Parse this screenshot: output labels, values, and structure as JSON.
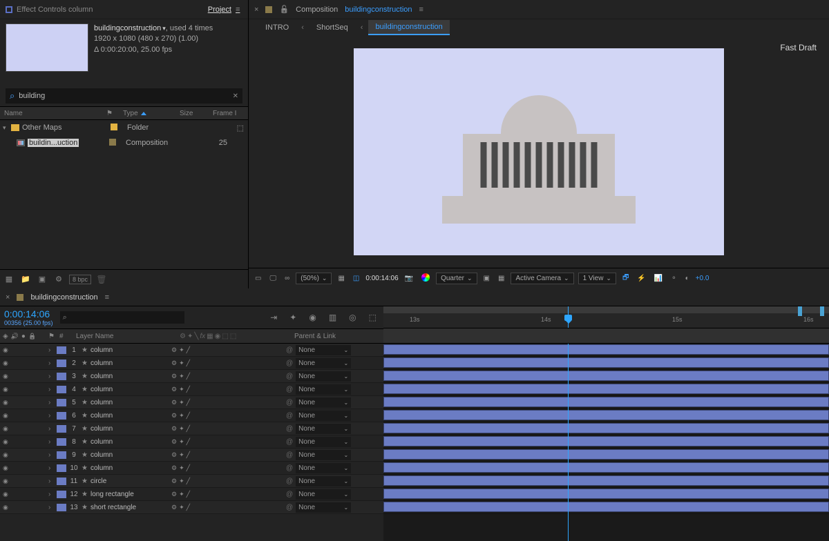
{
  "projectPanel": {
    "tabInactive": "Effect Controls column",
    "tabActive": "Project",
    "compName": "buildingconstruction",
    "usedText": ", used 4 times",
    "dims": "1920 x 1080  (480 x 270) (1.00)",
    "duration": "Δ 0:00:20:00, 25.00 fps",
    "searchValue": "building",
    "headers": {
      "name": "Name",
      "type": "Type",
      "size": "Size",
      "frame": "Frame I"
    },
    "folderRow": {
      "name": "Other Maps",
      "type": "Folder"
    },
    "compRow": {
      "name": "buildin...uction",
      "type": "Composition",
      "frame": "25"
    },
    "bpc": "8 bpc"
  },
  "compPanel": {
    "tabPrefix": "Composition",
    "tabName": "buildingconstruction",
    "breadcrumb": [
      "INTRO",
      "ShortSeq",
      "buildingconstruction"
    ],
    "fastDraft": "Fast Draft",
    "zoom": "(50%)",
    "time": "0:00:14:06",
    "quality": "Quarter",
    "camera": "Active Camera",
    "view": "1 View",
    "exposure": "+0.0"
  },
  "timeline": {
    "tabName": "buildingconstruction",
    "time": "0:00:14:06",
    "frames": "00356 (25.00 fps)",
    "colNum": "#",
    "colName": "Layer Name",
    "colParent": "Parent & Link",
    "parentNone": "None",
    "ticks": [
      "13s",
      "14s",
      "15s",
      "16s"
    ],
    "layers": [
      {
        "n": "1",
        "name": "column"
      },
      {
        "n": "2",
        "name": "column"
      },
      {
        "n": "3",
        "name": "column"
      },
      {
        "n": "4",
        "name": "column"
      },
      {
        "n": "5",
        "name": "column"
      },
      {
        "n": "6",
        "name": "column"
      },
      {
        "n": "7",
        "name": "column"
      },
      {
        "n": "8",
        "name": "column"
      },
      {
        "n": "9",
        "name": "column"
      },
      {
        "n": "10",
        "name": "column"
      },
      {
        "n": "11",
        "name": "circle"
      },
      {
        "n": "12",
        "name": "long rectangle"
      },
      {
        "n": "13",
        "name": "short rectangle"
      }
    ]
  }
}
